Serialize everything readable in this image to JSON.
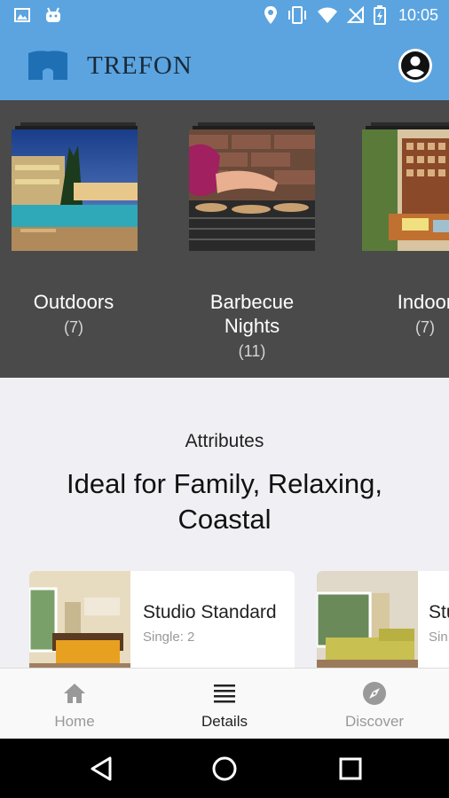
{
  "status": {
    "time": "10:05"
  },
  "brand": {
    "name": "TREFON"
  },
  "categories": [
    {
      "name_line1": "Outdoors",
      "name_line2": "",
      "count": "(7)"
    },
    {
      "name_line1": "Barbecue",
      "name_line2": "Nights",
      "count": "(11)"
    },
    {
      "name_line1": "Indoor",
      "name_line2": "",
      "count": "(7)"
    }
  ],
  "attributes": {
    "title": "Attributes",
    "values": "Ideal for Family, Relaxing, Coastal"
  },
  "rooms": [
    {
      "name": "Studio Standard",
      "sub": "Single: 2"
    },
    {
      "name": "Stu",
      "sub": "Sin"
    }
  ],
  "nav": {
    "items": [
      {
        "label": "Home",
        "icon": "home-icon"
      },
      {
        "label": "Details",
        "icon": "list-icon"
      },
      {
        "label": "Discover",
        "icon": "compass-icon"
      }
    ],
    "active": "Details"
  },
  "colors": {
    "app_bar": "#5ba4e0",
    "gallery_bg": "#4a4a4a",
    "page_bg": "#efeff4",
    "nav_active": "#222222",
    "nav_inactive": "#999999"
  }
}
